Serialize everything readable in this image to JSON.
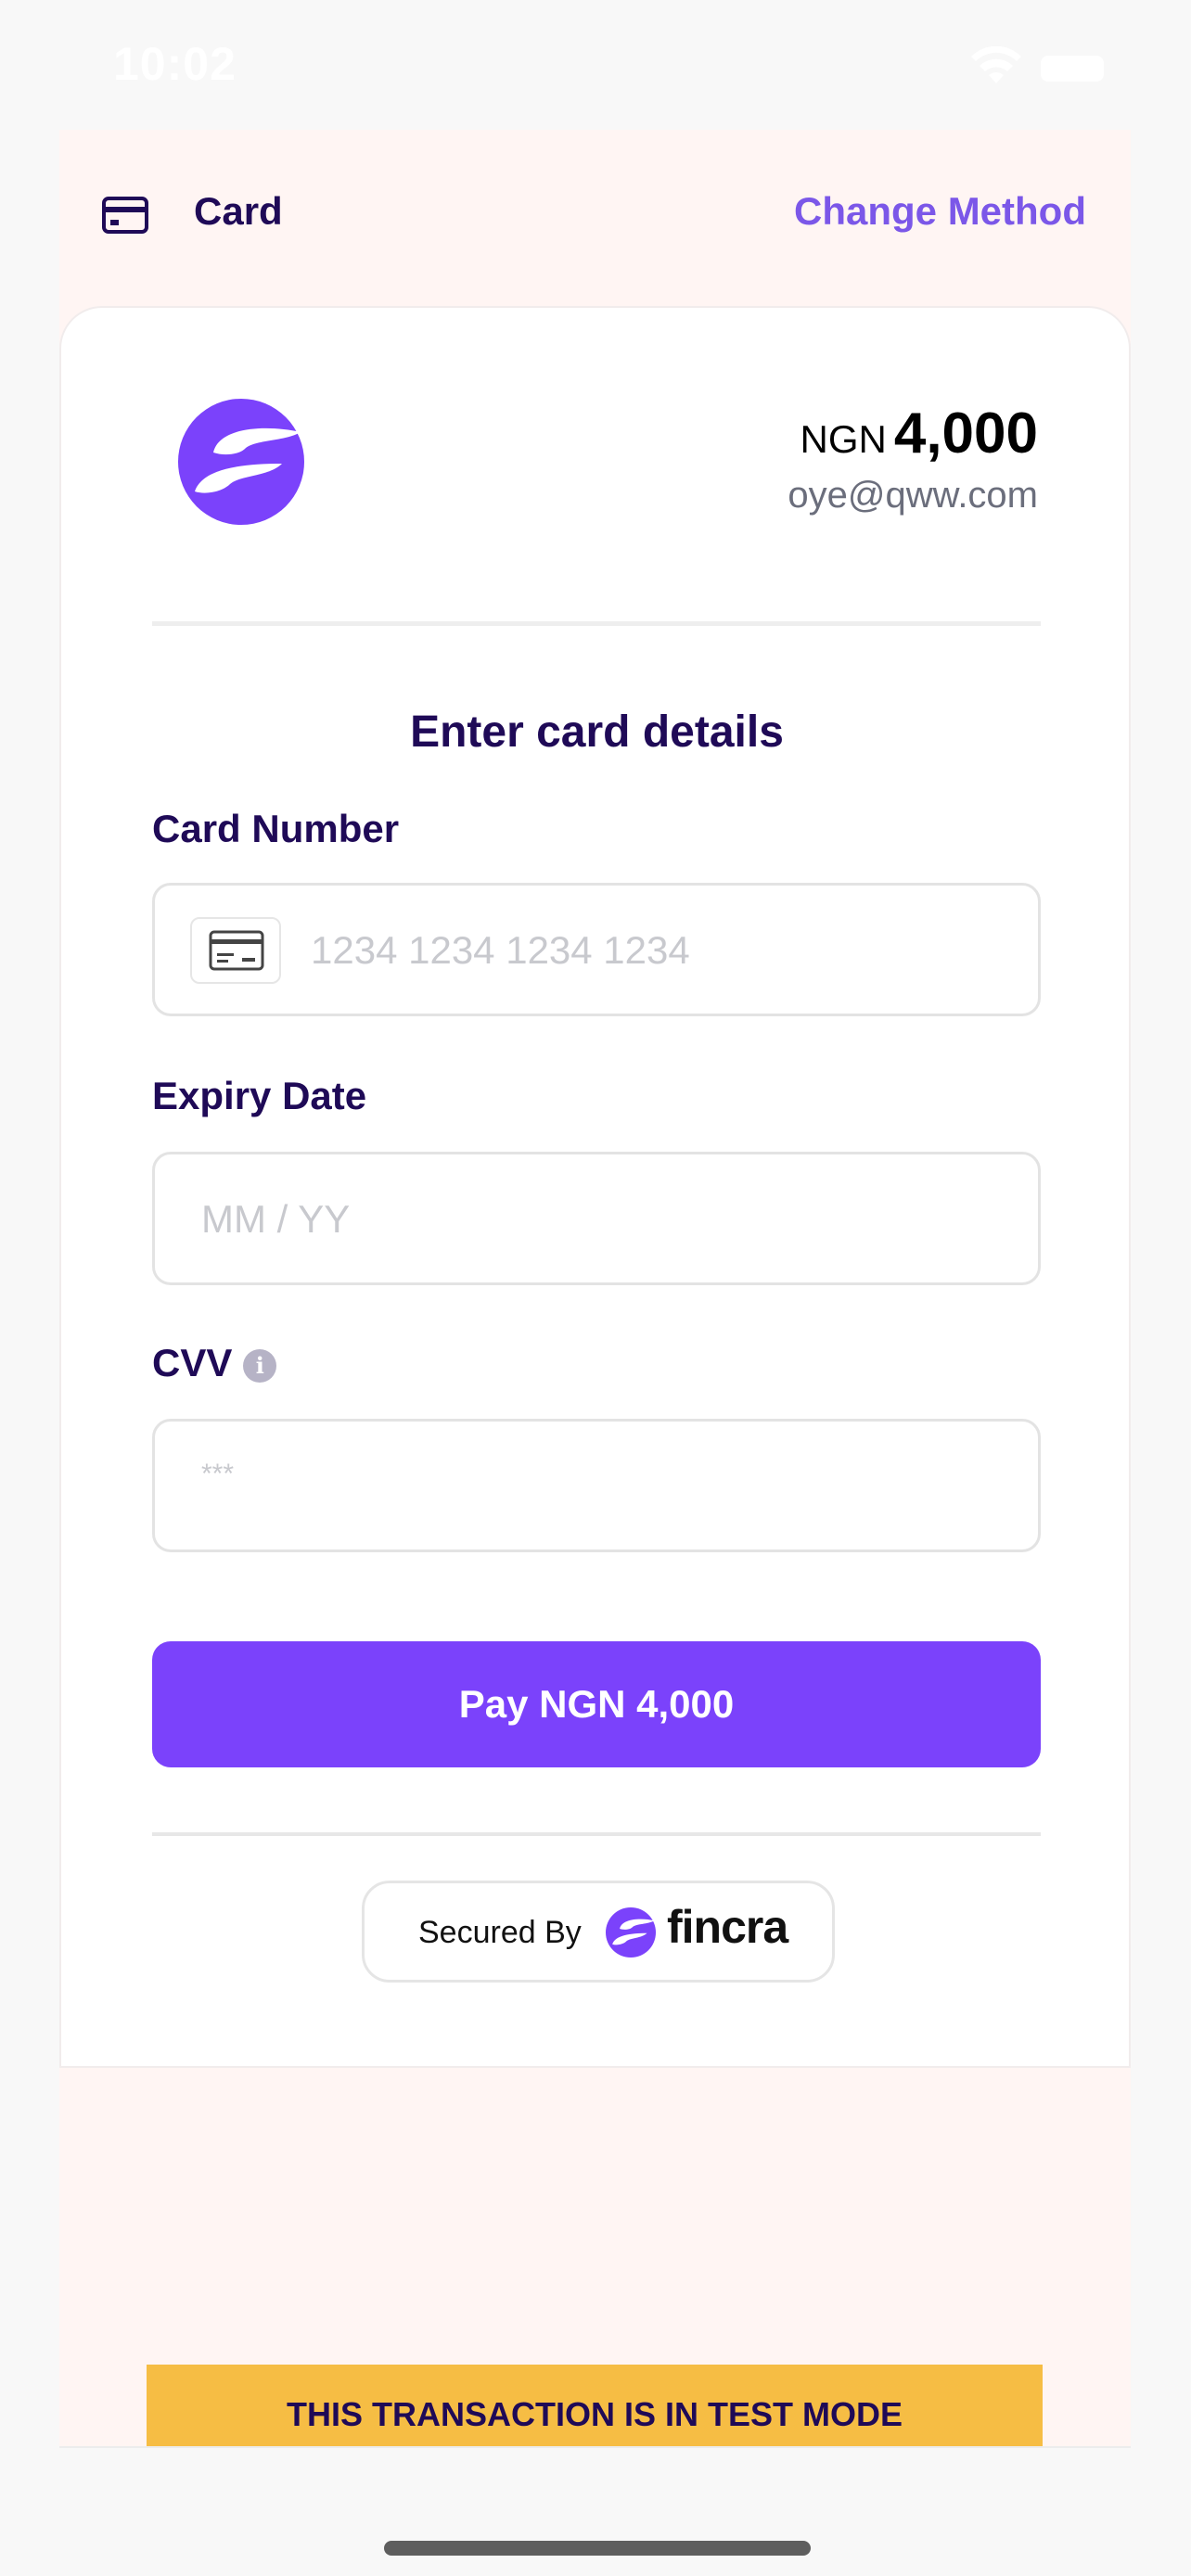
{
  "status_bar": {
    "time": "10:02"
  },
  "header": {
    "title": "Card",
    "change_method": "Change Method"
  },
  "summary": {
    "currency": "NGN",
    "amount": "4,000",
    "email": "oye@qww.com"
  },
  "form": {
    "title": "Enter card details",
    "card_number": {
      "label": "Card Number",
      "placeholder": "1234 1234 1234 1234"
    },
    "expiry": {
      "label": "Expiry Date",
      "placeholder": "MM / YY"
    },
    "cvv": {
      "label": "CVV",
      "placeholder": "***",
      "info_glyph": "i"
    }
  },
  "pay_button": {
    "label": "Pay NGN 4,000"
  },
  "footer": {
    "secured_by": "Secured By",
    "brand": "fincra"
  },
  "test_banner": "THIS TRANSACTION IS IN TEST MODE",
  "colors": {
    "primary": "#7b42fb",
    "accent_text": "#7b57e8",
    "heading": "#1f0a57",
    "sheet_bg": "#fff5f3",
    "banner": "#f6bd44"
  },
  "icons": [
    "wifi-icon",
    "battery-icon",
    "card-icon",
    "fincra-logo-icon",
    "card-input-icon",
    "info-icon"
  ]
}
